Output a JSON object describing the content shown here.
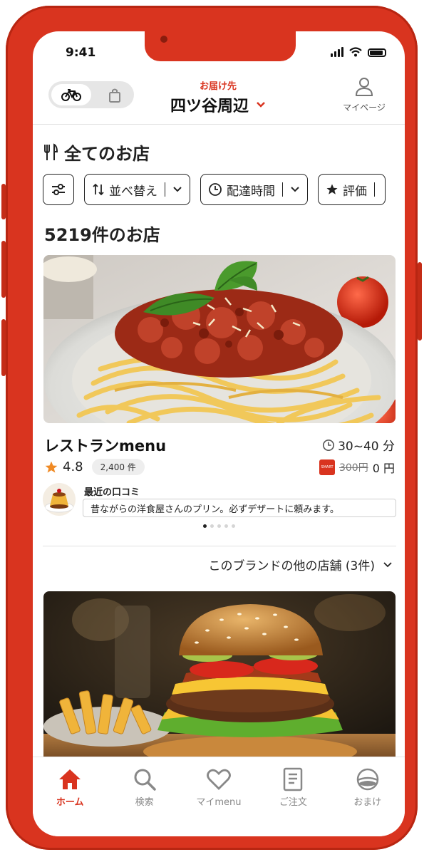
{
  "status": {
    "time": "9:41"
  },
  "header": {
    "delivery_label": "お届け先",
    "address": "四ツ谷周辺",
    "mypage_label": "マイページ",
    "mode_icons": [
      "bicycle-icon",
      "bag-icon"
    ]
  },
  "section": {
    "title": "全てのお店"
  },
  "filters": [
    {
      "label": "並べ替え",
      "icon": "sort-icon"
    },
    {
      "label": "配達時間",
      "icon": "clock-icon"
    },
    {
      "label": "評価",
      "icon": "star-icon"
    }
  ],
  "store_count": "5219件のお店",
  "restaurant": {
    "name": "レストランmenu",
    "eta": "30~40 分",
    "rating": "4.8",
    "review_count": "2,400 件",
    "fee_old": "300円",
    "fee_new": "0 円",
    "review_label": "最近の口コミ",
    "review_text": "昔ながらの洋食屋さんのプリン。必ずデザートに頼みます。"
  },
  "carousel": {
    "total": 5,
    "active": 1
  },
  "more_stores": "このブランドの他の店舗 (3件)",
  "tabs": [
    {
      "label": "ホーム",
      "icon": "home-icon",
      "active": true
    },
    {
      "label": "検索",
      "icon": "search-icon",
      "active": false
    },
    {
      "label": "マイmenu",
      "icon": "heart-icon",
      "active": false
    },
    {
      "label": "ご注文",
      "icon": "receipt-icon",
      "active": false
    },
    {
      "label": "おまけ",
      "icon": "bonus-icon",
      "active": false
    }
  ],
  "colors": {
    "brand": "#d9341f",
    "star": "#f08a24"
  }
}
